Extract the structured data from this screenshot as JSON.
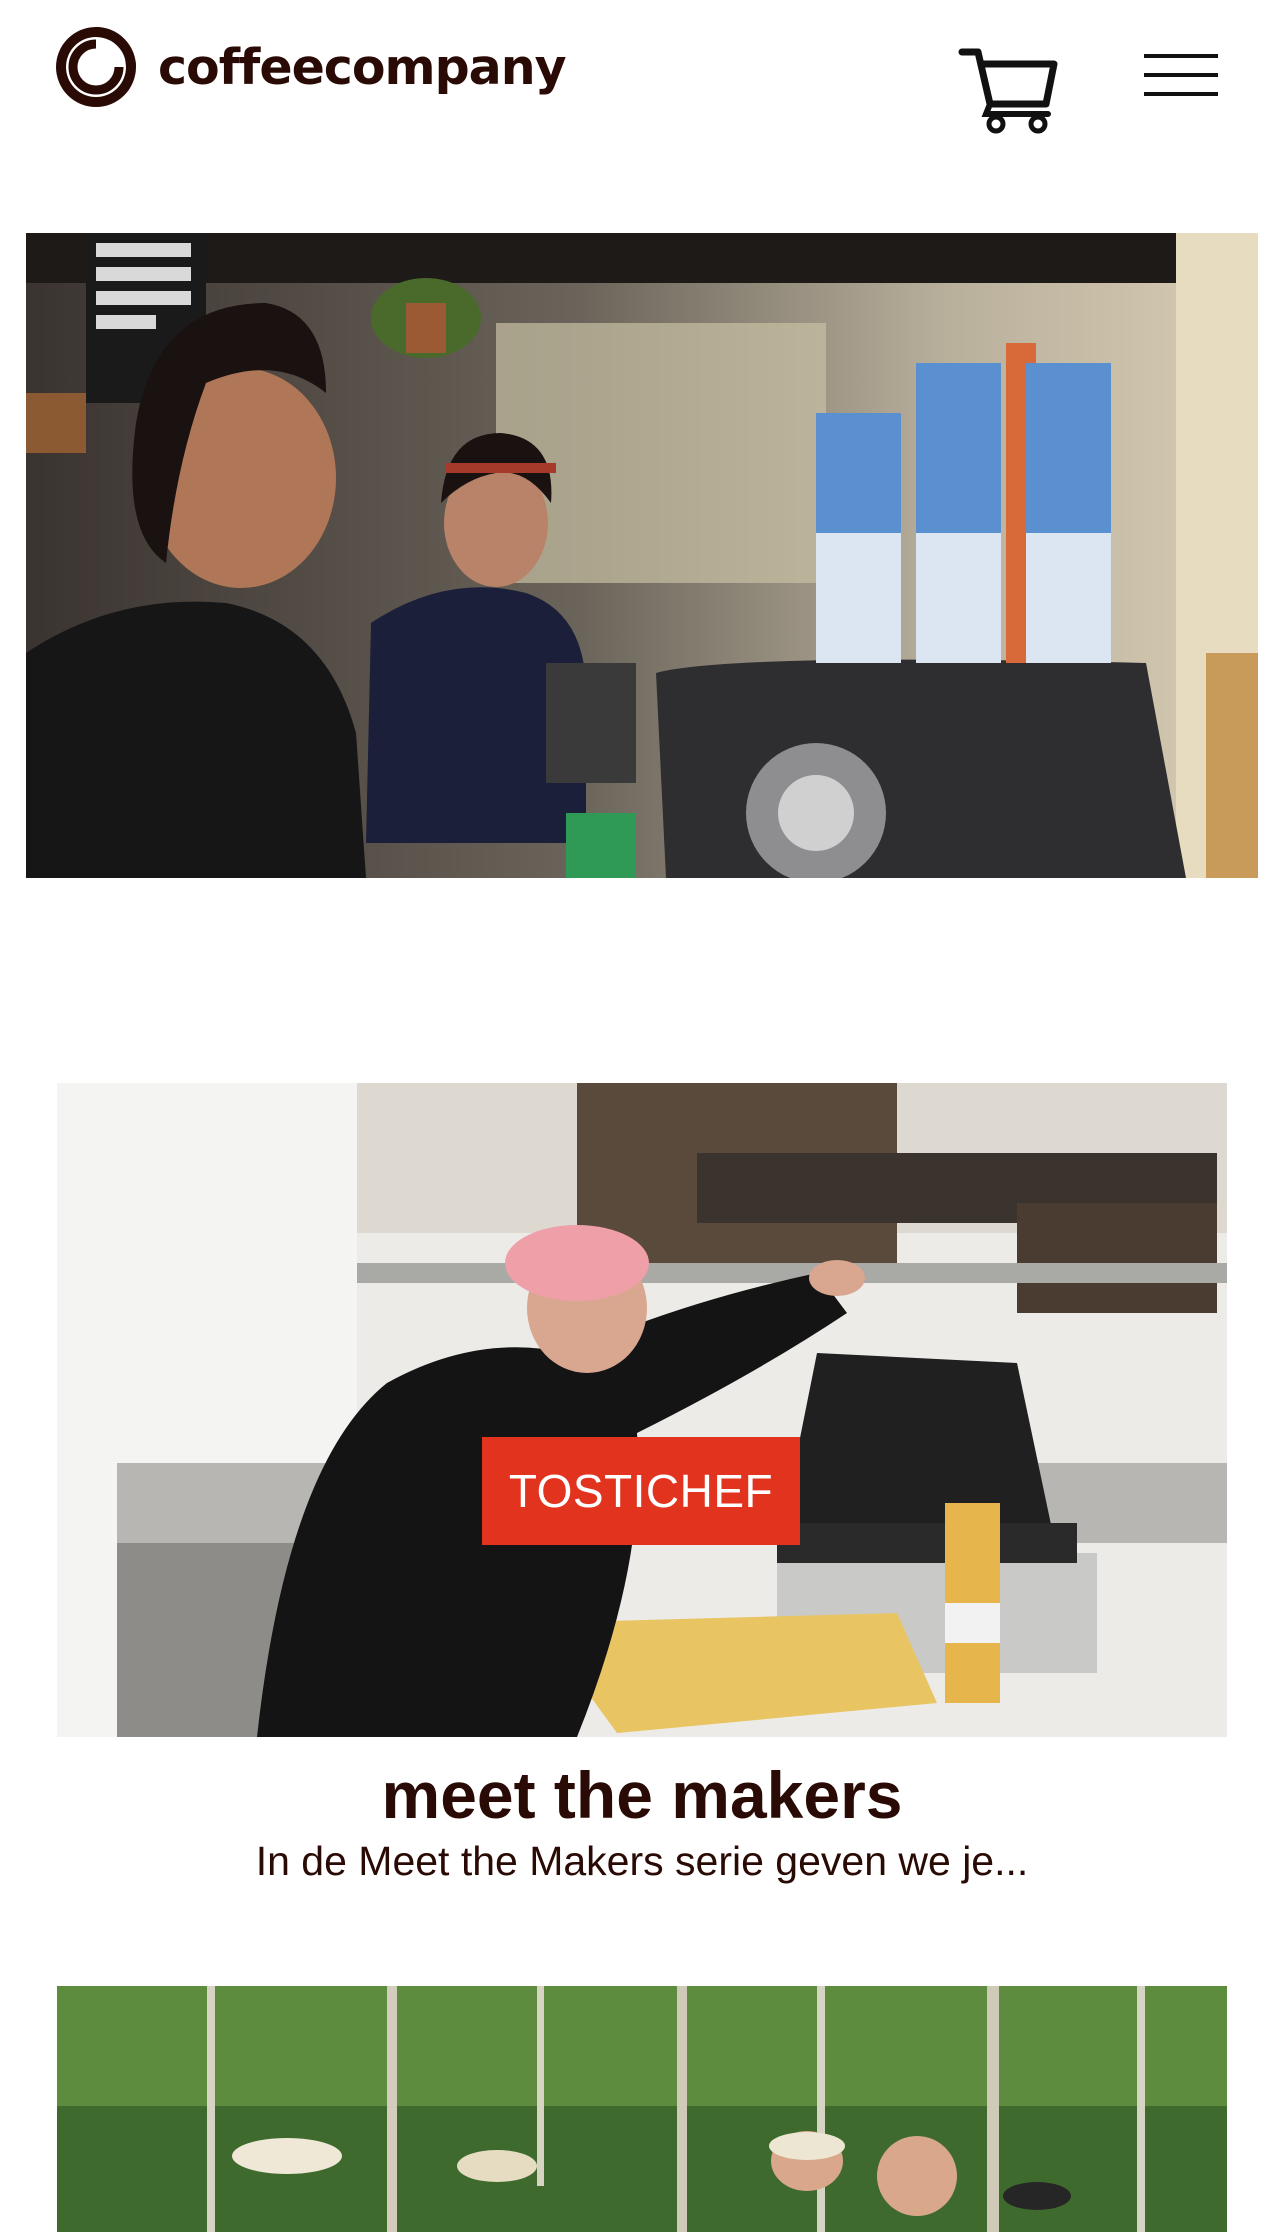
{
  "header": {
    "brand": "coffeecompany",
    "logo_icon": "coffeecompany-logo-icon",
    "cart_icon": "cart-icon",
    "menu_icon": "hamburger-menu-icon"
  },
  "hero": {
    "image": "baristas-at-espresso-machine"
  },
  "articles": [
    {
      "image": "man-making-toastie",
      "badge": "TOSTICHEF",
      "title": "meet the makers",
      "excerpt": "In de Meet the Makers serie geven we je..."
    },
    {
      "image": "group-in-forest"
    }
  ],
  "colors": {
    "brand": "#2a0a05",
    "badge": "#e2331f",
    "background": "#ffffff"
  }
}
